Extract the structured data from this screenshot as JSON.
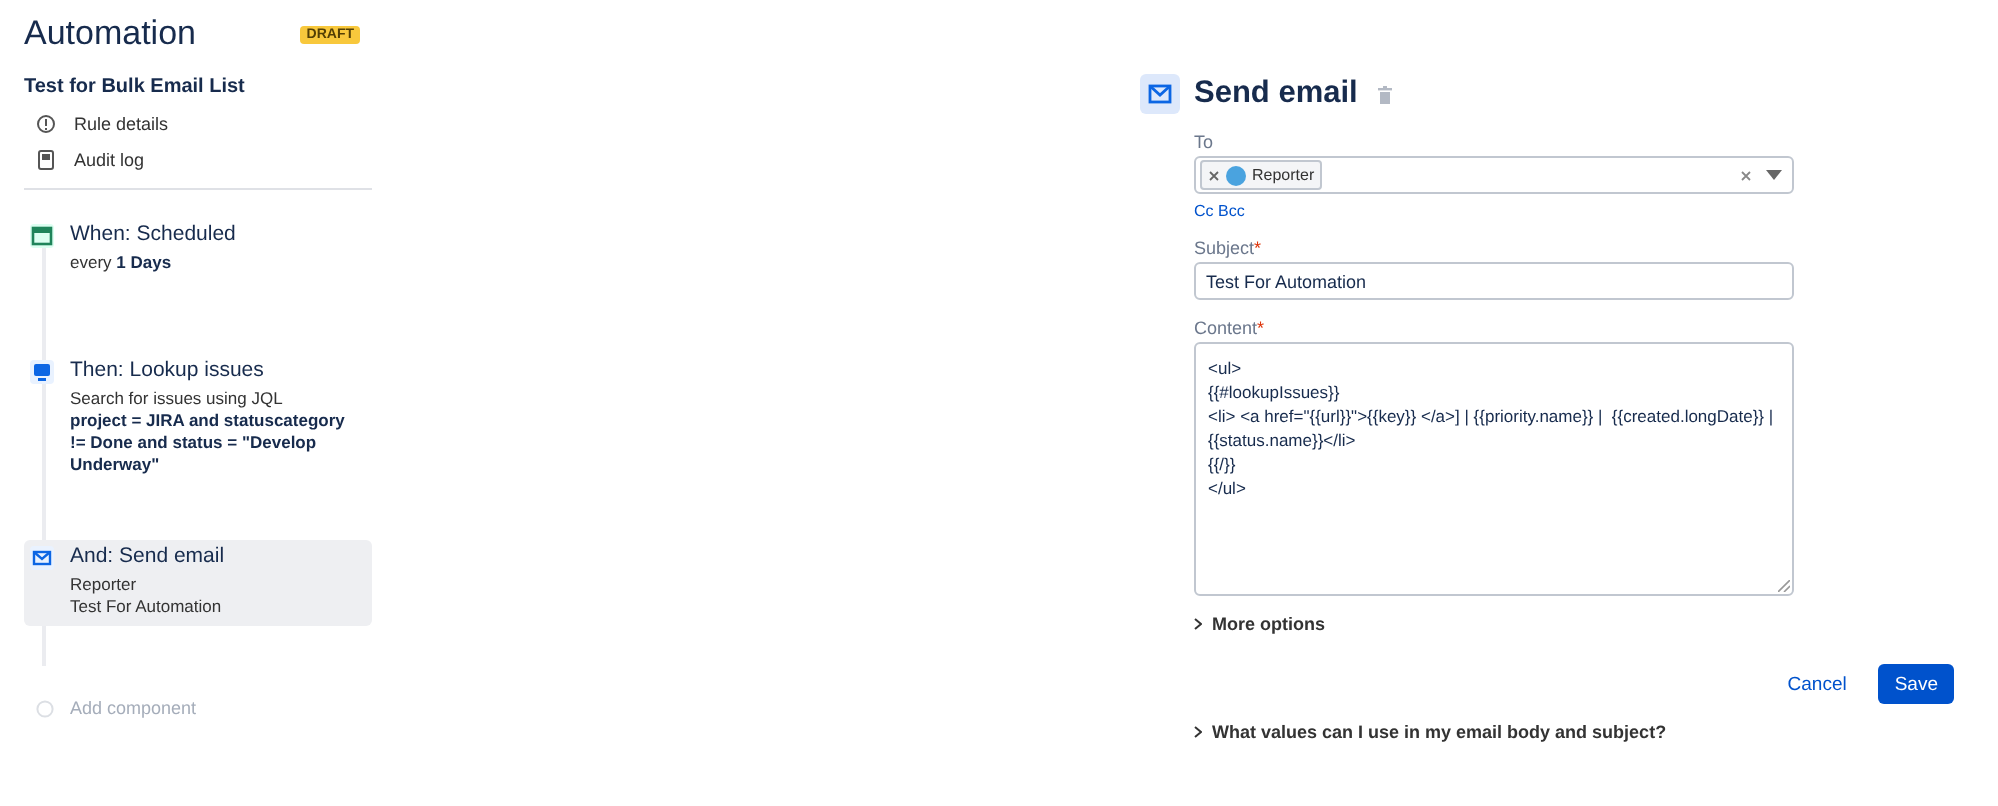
{
  "header": {
    "title": "Automation",
    "badge": "DRAFT"
  },
  "rule": {
    "name": "Test for Bulk Email List",
    "links": [
      {
        "kind": "info",
        "label": "Rule details"
      },
      {
        "kind": "log",
        "label": "Audit log"
      }
    ]
  },
  "steps": [
    {
      "kind": "trigger",
      "title": "When: Scheduled",
      "lines": [
        "every **1 Days**"
      ],
      "selected": false
    },
    {
      "kind": "lookup",
      "title": "Then: Lookup issues",
      "lines": [
        "Search for issues using JQL",
        "**project = JIRA and statuscategory != Done and status = \"Develop Underway\"**"
      ],
      "selected": false
    },
    {
      "kind": "email",
      "title": "And: Send email",
      "lines": [
        "Reporter",
        "Test For Automation"
      ],
      "selected": true
    }
  ],
  "add_component": "Add component",
  "panel": {
    "title": "Send email",
    "to": {
      "label": "To",
      "chips": [
        "Reporter"
      ]
    },
    "cc_bcc": "Cc Bcc",
    "subject": {
      "label": "Subject",
      "required_mark": "*",
      "value": "Test For Automation"
    },
    "content": {
      "label": "Content",
      "required_mark": "*",
      "lines": [
        "<ul>",
        "{{#lookupIssues}}",
        "<li> <a href=\"{{url}}\">{{key}} </a>] | {{priority.name}} |  {{created.longDate}} |",
        "{{status.name}}</li>",
        "{{/}}",
        "</ul>"
      ]
    },
    "more_options": "More options",
    "buttons": [
      {
        "kind": "subtle",
        "label": "Cancel"
      },
      {
        "kind": "primary",
        "label": "Save"
      }
    ],
    "help": "What values can I use in my email body and subject?"
  }
}
